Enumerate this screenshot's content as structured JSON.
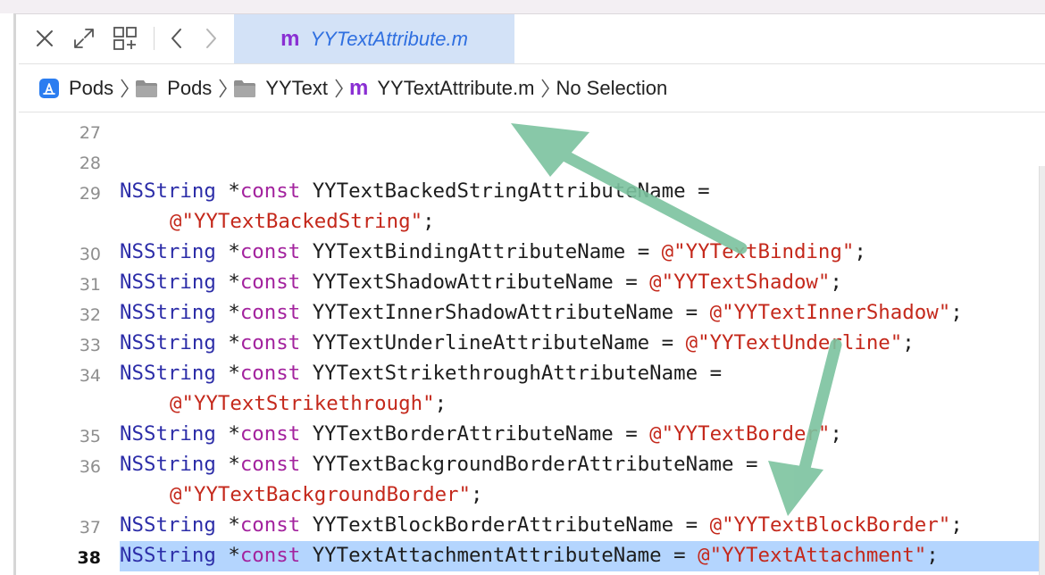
{
  "window": {
    "active_tab": {
      "label": "YYTextAttribute.m",
      "icon": "objc-m-file-icon"
    }
  },
  "toolbar": {
    "buttons": [
      "close-icon",
      "expand-icon",
      "grid-icon",
      "back-icon",
      "forward-icon"
    ]
  },
  "breadcrumb": [
    {
      "label": "Pods",
      "icon": "project-app-icon"
    },
    {
      "label": "Pods",
      "icon": "folder-icon"
    },
    {
      "label": "YYText",
      "icon": "folder-icon"
    },
    {
      "label": "YYTextAttribute.m",
      "icon": "objc-m-file-icon"
    },
    {
      "label": "No Selection",
      "icon": ""
    }
  ],
  "editor": {
    "current_line": "38",
    "code": {
      "type": "NSString",
      "star": "*",
      "kw": "const",
      "eq": "=",
      "at": "@",
      "q": "\"",
      "semi": ";"
    },
    "lines": [
      {
        "no": "27"
      },
      {
        "no": "28"
      },
      {
        "no": "29",
        "name": "YYTextBackedStringAttributeName",
        "value": "YYTextBackedString"
      },
      {
        "no": "30",
        "name": "YYTextBindingAttributeName",
        "value": "YYTextBinding"
      },
      {
        "no": "31",
        "name": "YYTextShadowAttributeName",
        "value": "YYTextShadow"
      },
      {
        "no": "32",
        "name": "YYTextInnerShadowAttributeName",
        "value": "YYTextInnerShadow"
      },
      {
        "no": "33",
        "name": "YYTextUnderlineAttributeName",
        "value": "YYTextUnderline"
      },
      {
        "no": "34",
        "name": "YYTextStrikethroughAttributeName",
        "value": "YYTextStrikethrough"
      },
      {
        "no": "35",
        "name": "YYTextBorderAttributeName",
        "value": "YYTextBorder"
      },
      {
        "no": "36",
        "name": "YYTextBackgroundBorderAttributeName",
        "value": "YYTextBackgroundBorder"
      },
      {
        "no": "37",
        "name": "YYTextBlockBorderAttributeName",
        "value": "YYTextBlockBorder"
      },
      {
        "no": "38",
        "name": "YYTextAttachmentAttributeName",
        "value": "YYTextAttachment"
      }
    ]
  },
  "colors": {
    "type": "#2c2da8",
    "keyword": "#a3239e",
    "string": "#c4281b",
    "selection": "#b4d5fe",
    "tab_active": "#d3e2f7",
    "arrow": "#7cc39f"
  }
}
